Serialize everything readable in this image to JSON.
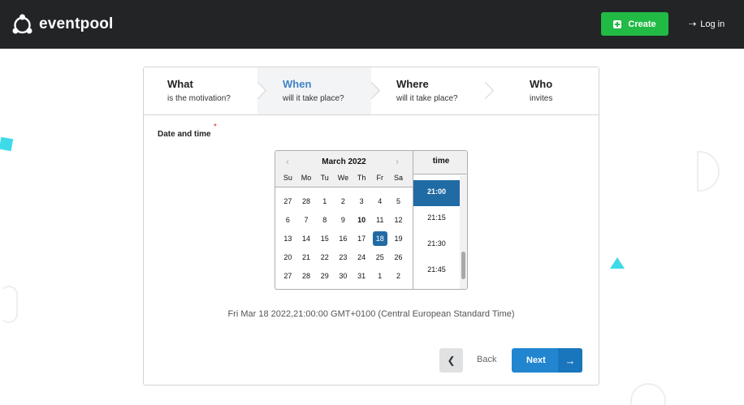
{
  "header": {
    "brand": "eventpool",
    "create_label": "Create",
    "login_label": "Log in"
  },
  "steps": [
    {
      "title": "What",
      "description": "is the motivation?",
      "active": false
    },
    {
      "title": "When",
      "description": "will it take place?",
      "active": true
    },
    {
      "title": "Where",
      "description": "will it take place?",
      "active": false
    },
    {
      "title": "Who",
      "description": "invites",
      "active": false
    }
  ],
  "form": {
    "field_label": "Date and time",
    "required_mark": "*"
  },
  "datepicker": {
    "month_label": "March 2022",
    "weekdays": [
      "Su",
      "Mo",
      "Tu",
      "We",
      "Th",
      "Fr",
      "Sa"
    ],
    "weeks": [
      [
        "27",
        "28",
        "1",
        "2",
        "3",
        "4",
        "5"
      ],
      [
        "6",
        "7",
        "8",
        "9",
        "10",
        "11",
        "12"
      ],
      [
        "13",
        "14",
        "15",
        "16",
        "17",
        "18",
        "19"
      ],
      [
        "20",
        "21",
        "22",
        "23",
        "24",
        "25",
        "26"
      ],
      [
        "27",
        "28",
        "29",
        "30",
        "31",
        "1",
        "2"
      ]
    ],
    "today": "10",
    "selected_day": "18",
    "time_header": "time",
    "times": [
      "21:00",
      "21:15",
      "21:30",
      "21:45"
    ],
    "selected_time": "21:00"
  },
  "selected_datetime_text": "Fri Mar 18 2022,21:00:00 GMT+0100 (Central European Standard Time)",
  "navigation": {
    "back_label": "Back",
    "next_label": "Next"
  },
  "colors": {
    "accent": "#2185d0",
    "create": "#21ba45",
    "selected": "#216ba5",
    "deco": "#3ddbe8"
  }
}
